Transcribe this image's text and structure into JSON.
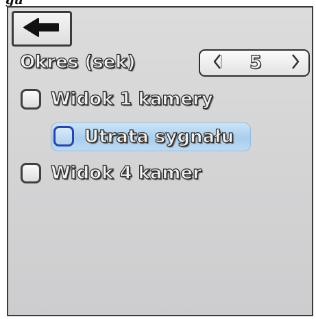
{
  "caption": "gu",
  "header": {
    "back_icon": "arrow-left-icon"
  },
  "period": {
    "label": "Okres (sek)",
    "value": "5",
    "decrease_icon": "chevron-left-icon",
    "increase_icon": "chevron-right-icon"
  },
  "options": [
    {
      "label": "Widok 1 kamery",
      "checked": false,
      "highlighted": false
    },
    {
      "label": "Utrata sygnału",
      "checked": false,
      "highlighted": true
    },
    {
      "label": "Widok 4 kamer",
      "checked": false,
      "highlighted": false
    }
  ],
  "colors": {
    "screen_bg": "#d5d5d6",
    "highlight": "#a8cdee",
    "selected_border": "#2747a8",
    "text_outline": "#2a2a2a"
  }
}
